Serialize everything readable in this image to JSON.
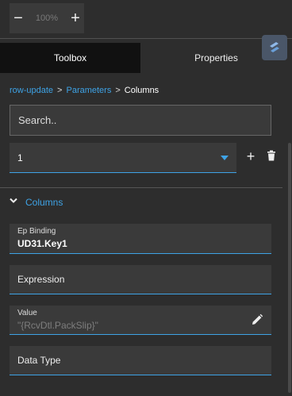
{
  "zoom": {
    "decrease_label": "−",
    "value": "100%",
    "increase_label": "+"
  },
  "tabs": [
    {
      "label": "Toolbox",
      "active": true
    },
    {
      "label": "Properties",
      "active": false
    }
  ],
  "breadcrumb": {
    "items": [
      "row-update",
      "Parameters",
      "Columns"
    ],
    "separator": ">"
  },
  "search": {
    "placeholder": "Search..",
    "value": ""
  },
  "row_selector": {
    "selected": "1"
  },
  "actions": {
    "add_label": "+"
  },
  "section": {
    "title": "Columns",
    "expanded": true
  },
  "fields": {
    "ep_binding": {
      "label": "Ep Binding",
      "value": "UD31.Key1"
    },
    "expression": {
      "label": "Expression",
      "value": ""
    },
    "value": {
      "label": "Value",
      "value": "\"{RcvDtl.PackSlip}\""
    },
    "data_type": {
      "label": "Data Type",
      "value": ""
    }
  },
  "icons": {
    "logo": "epicor-logo-icon",
    "add": "plus-icon",
    "delete": "trash-icon",
    "chevron": "chevron-down-icon",
    "edit": "pencil-icon",
    "dropdown": "caret-down-icon"
  },
  "colors": {
    "background": "#2d2d2d",
    "accent": "#3ea3e6",
    "field_bg": "#3a3a3a",
    "active_tab_bg": "#111111"
  }
}
